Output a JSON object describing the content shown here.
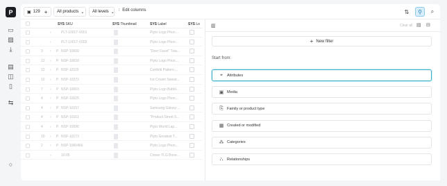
{
  "sidebar": {
    "logo": "P",
    "icons": [
      "product-icon",
      "image-icon",
      "download-icon",
      "layers-icon",
      "bag-icon",
      "book-icon",
      "arrows-icon",
      "help-icon"
    ]
  },
  "toolbar": {
    "count": "129",
    "add": "+",
    "products_select": "All products",
    "levels_select": "All levels",
    "edit_columns": "Edit columns",
    "chevron": "⌄"
  },
  "table": {
    "headers": {
      "sku_tag": "SYS",
      "sku": "SKU",
      "thumb_tag": "SYS",
      "thumb": "Thumbnail",
      "label_tag": "SYS",
      "label": "Label",
      "extra_tag": "SYS",
      "extra": "Lo"
    },
    "rows": [
      {
        "level": "",
        "prefix": "",
        "sku": "PLT-10017-V001",
        "label": "Plyto Logo Phon..."
      },
      {
        "level": "",
        "prefix": "",
        "sku": "PLT-10017-V002",
        "label": "Plyto Logo Phon..."
      },
      {
        "level": "3",
        "prefix": "P",
        "sku": "NSP-10009",
        "label": "\"Deer Facet\" Trav..."
      },
      {
        "level": "12",
        "prefix": "P",
        "sku": "NSP-10030",
        "label": "Plyto Logo Phon..."
      },
      {
        "level": "12",
        "prefix": "P",
        "sku": "NSP-10115",
        "label": "Confetti Pattern ..."
      },
      {
        "level": "12",
        "prefix": "P",
        "sku": "NSP-10272",
        "label": "Ice Cream Sweat..."
      },
      {
        "level": "7",
        "prefix": "P",
        "sku": "NSP-10003",
        "label": "Plyto Logo Bubbl..."
      },
      {
        "level": "4",
        "prefix": "P",
        "sku": "NSP-10025",
        "label": "Plyto Logo Phon..."
      },
      {
        "level": "4",
        "prefix": "P",
        "sku": "NSP-10157",
        "label": "Samsung Galaxy ..."
      },
      {
        "level": "4",
        "prefix": "P",
        "sku": "NSP-10161",
        "label": "\"Product Street S..."
      },
      {
        "level": "4",
        "prefix": "P",
        "sku": "NSP-10096",
        "label": "Plyto World Lap..."
      },
      {
        "level": "10",
        "prefix": "P",
        "sku": "NSP-10172",
        "label": "Plyto Greatest T..."
      },
      {
        "level": "2",
        "prefix": "P",
        "sku": "NSP-1000466",
        "label": "Plyto Logo Phon..."
      },
      {
        "level": "",
        "prefix": "",
        "sku": "10:05",
        "label": "Cinner TLG Bone..."
      }
    ]
  },
  "panel": {
    "clear_all": "Clear all",
    "new_filter": "New filter",
    "start_from": "Start from:",
    "options": [
      {
        "label": "Attributes",
        "icon": "tag-icon",
        "glyph": "⌖"
      },
      {
        "label": "Media",
        "icon": "image-icon",
        "glyph": "▣"
      },
      {
        "label": "Family or product type",
        "icon": "family-icon",
        "glyph": "⎘"
      },
      {
        "label": "Created or modified",
        "icon": "calendar-icon",
        "glyph": "▦"
      },
      {
        "label": "Categories",
        "icon": "categories-icon",
        "glyph": "⁂"
      },
      {
        "label": "Relationships",
        "icon": "relationships-icon",
        "glyph": "⛬"
      }
    ]
  },
  "colors": {
    "accent": "#3aaec8",
    "filter_active_bg": "#d9ecfa",
    "logo_bg": "#1c1d22"
  }
}
